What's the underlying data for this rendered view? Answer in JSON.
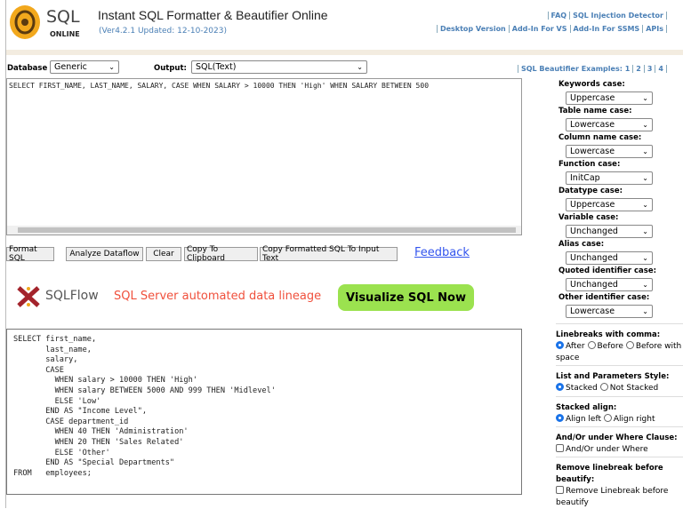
{
  "header": {
    "logo_text": "SQL",
    "logo_sub": "ONLINE",
    "title": "Instant SQL Formatter & Beautifier Online",
    "version": "(Ver4.2.1 Updated: 12-10-2023)",
    "links_top": [
      "FAQ",
      "SQL Injection Detector"
    ],
    "links_bottom": [
      "Desktop Version",
      "Add-In For VS",
      "Add-In For SSMS",
      "APIs"
    ]
  },
  "toolbar": {
    "database_label": "Database",
    "database_value": "Generic",
    "output_label": "Output:",
    "output_value": "SQL(Text)",
    "examples_label": "SQL Beautifier Examples: 1",
    "examples": [
      "2",
      "3",
      "4"
    ]
  },
  "input_sql": "SELECT FIRST_NAME, LAST_NAME, SALARY, CASE WHEN SALARY > 10000 THEN 'High' WHEN SALARY BETWEEN 500",
  "buttons": {
    "format": "Format SQL",
    "analyze": "Analyze Dataflow",
    "clear": "Clear",
    "copy": "Copy To Clipboard",
    "copy_formatted": "Copy Formatted SQL To Input Text",
    "feedback": "Feedback"
  },
  "banner": {
    "brand": "SQLFlow",
    "tagline": "SQL Server automated data lineage",
    "cta": "Visualize SQL Now"
  },
  "output_sql": "SELECT first_name,\n       last_name,\n       salary,\n       CASE\n         WHEN salary > 10000 THEN 'High'\n         WHEN salary BETWEEN 5000 AND 999 THEN 'Midlevel'\n         ELSE 'Low'\n       END AS \"Income Level\",\n       CASE department_id\n         WHEN 40 THEN 'Administration'\n         WHEN 20 THEN 'Sales Related'\n         ELSE 'Other'\n       END AS \"Special Departments\"\nFROM   employees;",
  "options": [
    {
      "label": "Keywords case:",
      "value": "Uppercase"
    },
    {
      "label": "Table name case:",
      "value": "Lowercase"
    },
    {
      "label": "Column name case:",
      "value": "Lowercase"
    },
    {
      "label": "Function case:",
      "value": "InitCap"
    },
    {
      "label": "Datatype case:",
      "value": "Uppercase"
    },
    {
      "label": "Variable case:",
      "value": "Unchanged"
    },
    {
      "label": "Alias case:",
      "value": "Unchanged"
    },
    {
      "label": "Quoted identifier case:",
      "value": "Unchanged"
    },
    {
      "label": "Other identifier case:",
      "value": "Lowercase"
    }
  ],
  "linebreaks": {
    "label": "Linebreaks with comma:",
    "opts": [
      "After",
      "Before",
      "Before with space"
    ]
  },
  "list_style": {
    "label": "List and Parameters Style:",
    "opts": [
      "Stacked",
      "Not Stacked"
    ]
  },
  "stacked_align": {
    "label": "Stacked align:",
    "opts": [
      "Align left",
      "Align right"
    ]
  },
  "andor": {
    "label": "And/Or under Where Clause:",
    "opt": "And/Or under Where"
  },
  "remove_lb": {
    "label": "Remove linebreak before beautify:",
    "opt": "Remove Linebreak before beautify"
  }
}
